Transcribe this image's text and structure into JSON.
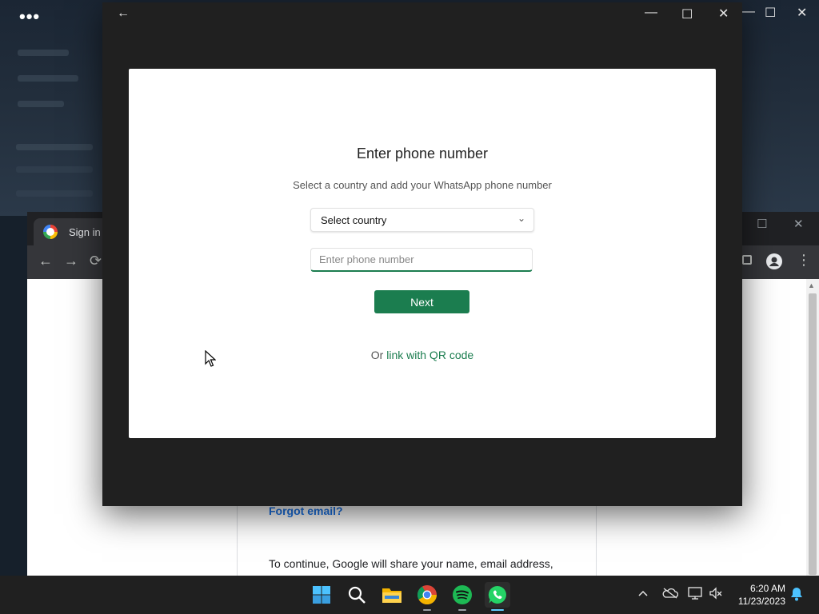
{
  "background_app": {
    "menu_dots": "•••",
    "controls": {
      "minimize": "—",
      "maximize": "☐",
      "close": "✕"
    }
  },
  "chrome": {
    "tab_title": "Sign in - G",
    "nav": {
      "back": "←",
      "forward": "→",
      "reload": "⟳"
    },
    "win_controls": {
      "maximize": "☐",
      "close": "✕"
    },
    "page": {
      "forgot_email": "Forgot email?",
      "continue_text": "To continue, Google will share your name, email address,"
    }
  },
  "whatsapp": {
    "back": "←",
    "window_controls": {
      "minimize": "—",
      "maximize": "☐",
      "close": "✕"
    },
    "heading": "Enter phone number",
    "subtitle": "Select a country and add your WhatsApp phone number",
    "country_select": {
      "value": "Select country",
      "chevron": "⌄"
    },
    "phone_input": {
      "placeholder": "Enter phone number",
      "value": ""
    },
    "next_button": "Next",
    "qr_prefix": "Or ",
    "qr_link": "link with QR code",
    "accent_color": "#1b7d4f"
  },
  "taskbar": {
    "apps": [
      {
        "name": "start-icon"
      },
      {
        "name": "search-icon"
      },
      {
        "name": "file-explorer-icon"
      },
      {
        "name": "chrome-icon"
      },
      {
        "name": "spotify-icon"
      },
      {
        "name": "whatsapp-icon"
      }
    ],
    "tray": {
      "chevron": "^",
      "network": "🖧",
      "volume": "🔈",
      "bell": "🔔"
    },
    "time": "6:20 AM",
    "date": "11/23/2023"
  }
}
